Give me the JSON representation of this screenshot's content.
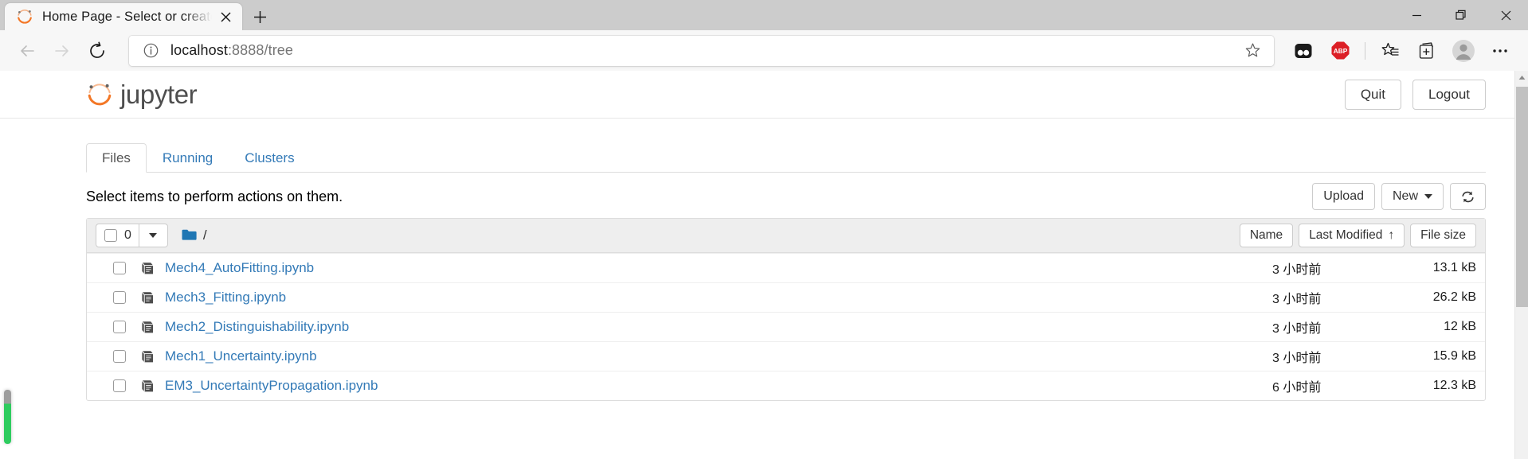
{
  "browser": {
    "tab": {
      "title": "Home Page - Select or create a n",
      "favicon_icon": "jupyter-favicon",
      "close_icon": "close-icon"
    },
    "newtab_icon": "plus-icon",
    "window_controls": {
      "minimize_icon": "minimize-icon",
      "restore_icon": "restore-icon",
      "close_icon": "window-close-icon"
    },
    "toolbar": {
      "back_icon": "back-arrow-icon",
      "forward_icon": "forward-arrow-icon",
      "reload_icon": "reload-icon",
      "info_icon": "site-info-icon",
      "url_host": "localhost",
      "url_path": ":8888/tree",
      "url_full": "localhost:8888/tree",
      "add_favorite_icon": "star-plus-icon",
      "extensions": [
        {
          "name": "extension-dark-icon",
          "label": ""
        },
        {
          "name": "adblock-plus-icon",
          "label": "ABP"
        }
      ],
      "favorites_icon": "favorites-list-icon",
      "collections_icon": "collections-icon",
      "profile_icon": "profile-avatar-icon",
      "settings_icon": "more-options-icon"
    }
  },
  "jupyter": {
    "logo_text": "jupyter",
    "logo_icon": "jupyter-logo-icon",
    "header_buttons": [
      {
        "label": "Quit",
        "name": "quit-button"
      },
      {
        "label": "Logout",
        "name": "logout-button"
      }
    ],
    "tabs": [
      {
        "label": "Files",
        "active": true
      },
      {
        "label": "Running",
        "active": false
      },
      {
        "label": "Clusters",
        "active": false
      }
    ],
    "action_bar": {
      "text": "Select items to perform actions on them.",
      "upload_label": "Upload",
      "new_label": "New",
      "refresh_icon": "refresh-icon"
    },
    "list_header": {
      "selected_count": "0",
      "select_all_caret_icon": "chevron-down-icon",
      "folder_icon": "folder-icon",
      "breadcrumb": "/",
      "sort_name": "Name",
      "sort_modified": "Last Modified",
      "sort_modified_arrow": "↑",
      "sort_size": "File size"
    },
    "files": [
      {
        "name": "Mech4_AutoFitting.ipynb",
        "modified": "3 小时前",
        "size": "13.1 kB",
        "icon": "notebook-icon"
      },
      {
        "name": "Mech3_Fitting.ipynb",
        "modified": "3 小时前",
        "size": "26.2 kB",
        "icon": "notebook-icon"
      },
      {
        "name": "Mech2_Distinguishability.ipynb",
        "modified": "3 小时前",
        "size": "12 kB",
        "icon": "notebook-icon"
      },
      {
        "name": "Mech1_Uncertainty.ipynb",
        "modified": "3 小时前",
        "size": "15.9 kB",
        "icon": "notebook-icon"
      },
      {
        "name": "EM3_UncertaintyPropagation.ipynb",
        "modified": "6 小时前",
        "size": "12.3 kB",
        "icon": "notebook-icon"
      }
    ]
  },
  "colors": {
    "jupyter_orange": "#F37726",
    "link_blue": "#337ab7",
    "chrome_gray": "#cccccc",
    "toolbar_gray": "#f7f7f7",
    "adblock_red": "#DC1F26",
    "indicator_green": "#2ecc5f"
  }
}
